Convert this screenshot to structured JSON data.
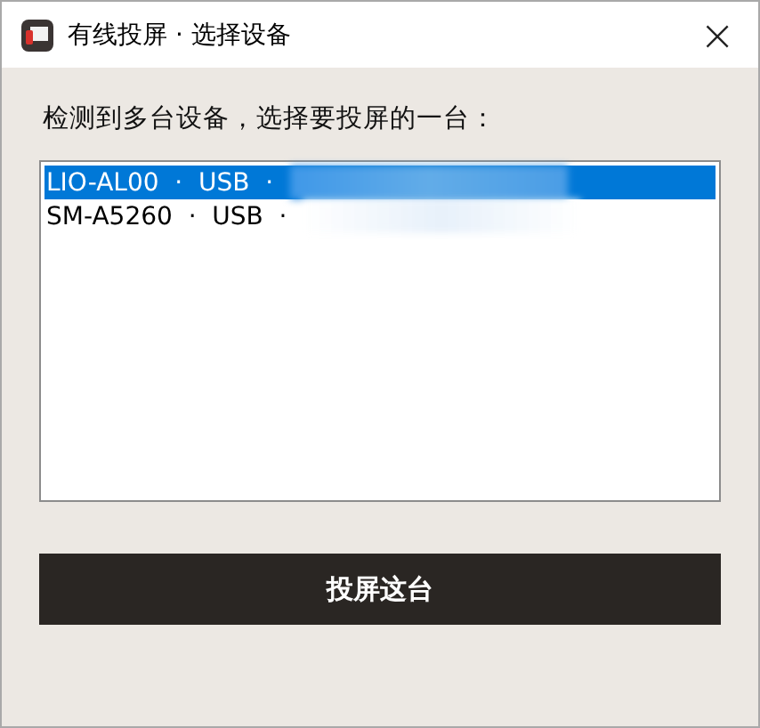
{
  "window": {
    "title": "有线投屏 · 选择设备",
    "close": "×"
  },
  "prompt": "检测到多台设备，选择要投屏的一台：",
  "devices": [
    {
      "label": "LIO-AL00  ·  USB  ·  ",
      "selected": true,
      "redacted": true
    },
    {
      "label": "SM-A5260  ·  USB  ·  ",
      "selected": false,
      "redacted": true
    }
  ],
  "button": "投屏这台"
}
